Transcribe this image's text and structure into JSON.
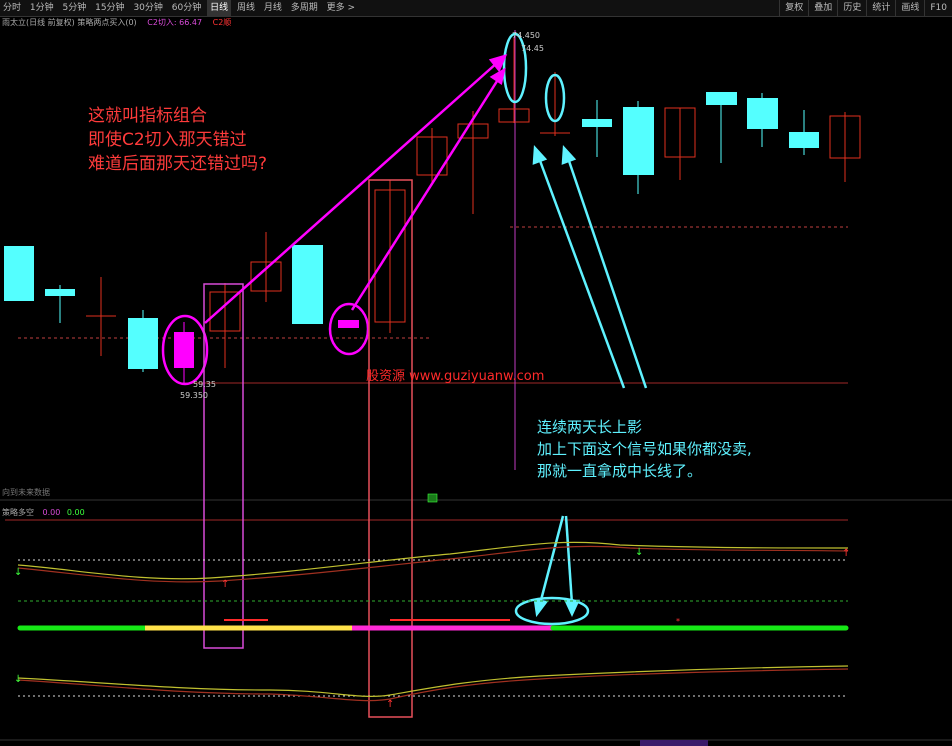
{
  "toolbar": {
    "tabs": [
      "分时",
      "1分钟",
      "5分钟",
      "15分钟",
      "30分钟",
      "60分钟",
      "日线",
      "周线",
      "月线",
      "多周期",
      "更多 >"
    ],
    "active": "日线",
    "right_buttons": [
      "复权",
      "叠加",
      "历史",
      "统计",
      "画线",
      "F10"
    ]
  },
  "info": {
    "stock": "雨太立(日线 前复权)",
    "indicator": "策略两点买入(0)",
    "c2_label": "C2切入: 66.47",
    "c2b_label": "C2顺"
  },
  "annotations": {
    "red_lines": [
      "这就叫指标组合",
      "即使C2切入那天错过",
      "难道后面那天还错过吗?"
    ],
    "cyan_lines": [
      "连续两天长上影",
      "加上下面这个信号如果你都没卖,",
      "那就一直拿成中长线了。"
    ],
    "watermark": "股资源 www.guziyuanw.com"
  },
  "prices": {
    "high_label": "74.450",
    "high_label2": "74.45",
    "low_label": "59.35",
    "low_label2": "59.350"
  },
  "sub_panel": {
    "future_text": "向到未来数据",
    "title": "策略多空",
    "value1": "0.00",
    "value2": "0.00"
  },
  "colors": {
    "up": "#e0301e",
    "down": "#54ffff",
    "highlight": "#ff00ff",
    "annotation_red": "#ff3b3b",
    "annotation_cyan": "#5ff2ff",
    "bar_green": "#16e816",
    "bar_yellow": "#ffe24a",
    "bar_magenta": "#ff2bd6"
  }
}
